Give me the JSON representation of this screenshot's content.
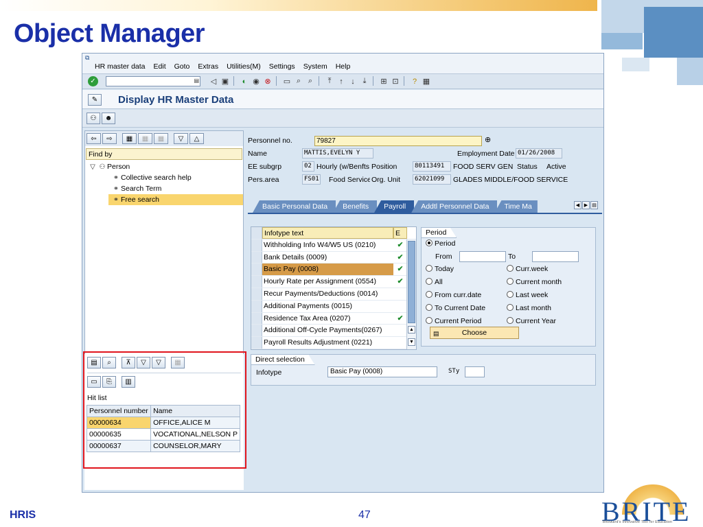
{
  "slide": {
    "title": "Object Manager",
    "footer_left": "HRIS",
    "page_number": "47",
    "logo_word": "BRITE",
    "logo_tagline": "BRoward's Innovative Tool for Education"
  },
  "menu": [
    "HR master data",
    "Edit",
    "Goto",
    "Extras",
    "Utilities(M)",
    "Settings",
    "System",
    "Help"
  ],
  "screen_title": "Display HR Master Data",
  "left_pane": {
    "find_by": "Find by",
    "tree": {
      "person": "Person",
      "items": [
        "Collective search help",
        "Search Term",
        "Free search"
      ]
    },
    "hit_list": {
      "label": "Hit list",
      "columns": [
        "Personnel number",
        "Name"
      ],
      "rows": [
        {
          "number": "00000634",
          "name": "OFFICE,ALICE M"
        },
        {
          "number": "00000635",
          "name": "VOCATIONAL,NELSON P"
        },
        {
          "number": "00000637",
          "name": "COUNSELOR,MARY"
        }
      ]
    }
  },
  "header": {
    "personnel_no_label": "Personnel no.",
    "personnel_no": "79827",
    "name_label": "Name",
    "name": "MATTIS,EVELYN Y",
    "employment_date_label": "Employment Date",
    "employment_date": "01/26/2008",
    "ee_subgrp_label": "EE subgrp",
    "ee_subgrp_code": "02",
    "ee_subgrp_text": "Hourly  (w/Benfts",
    "position_label": "Position",
    "position_code": "80113491",
    "position_text": "FOOD SERV GEN",
    "status_label": "Status",
    "status_value": "Active",
    "pers_area_label": "Pers.area",
    "pers_area_code": "FS01",
    "pers_area_text": "Food Service",
    "org_unit_label": "Org. Unit",
    "org_unit_code": "62021099",
    "org_unit_text": "GLADES MIDDLE/FOOD SERVICE"
  },
  "tabs": [
    "Basic Personal Data",
    "Benefits",
    "Payroll",
    "Addtl Personnel Data",
    "Time Ma"
  ],
  "active_tab": "Payroll",
  "infotypes": {
    "header_text": "Infotype text",
    "header_e": "E",
    "rows": [
      {
        "text": "Withholding Info W4/W5 US (0210)",
        "check": "✔"
      },
      {
        "text": "Bank Details (0009)",
        "check": "✔"
      },
      {
        "text": "Basic Pay (0008)",
        "check": "✔"
      },
      {
        "text": "Hourly Rate per Assignment (0554)",
        "check": "✔"
      },
      {
        "text": "Recur Payments/Deductions (0014)",
        "check": ""
      },
      {
        "text": "Additional Payments (0015)",
        "check": ""
      },
      {
        "text": "Residence Tax Area (0207)",
        "check": "✔"
      },
      {
        "text": "Additional Off-Cycle Payments(0267)",
        "check": ""
      },
      {
        "text": "Payroll Results Adjustment (0221)",
        "check": ""
      }
    ]
  },
  "period": {
    "title": "Period",
    "period_option": "Period",
    "from_label": "From",
    "to_label": "To",
    "today": "Today",
    "curr_week": "Curr.week",
    "all": "All",
    "current_month": "Current month",
    "from_curr_date": "From curr.date",
    "last_week": "Last week",
    "to_current_date": "To Current Date",
    "last_month": "Last month",
    "current_period": "Current Period",
    "current_year": "Current Year",
    "choose": "Choose"
  },
  "direct_selection": {
    "title": "Direct selection",
    "infotype_label": "Infotype",
    "infotype_value": "Basic Pay (0008)",
    "sty_label": "STy"
  }
}
